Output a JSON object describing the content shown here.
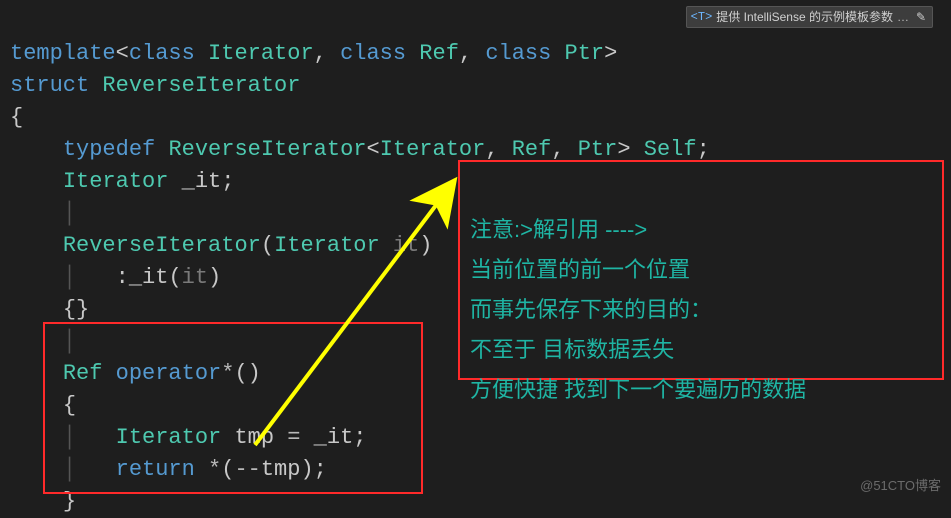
{
  "code": {
    "l1": {
      "kw1": "template",
      "punc1": "<",
      "kw2": "class",
      "sp": " ",
      "t1": "Iterator",
      "c": ", ",
      "kw3": "class",
      "t2": "Ref",
      "kw4": "class",
      "t3": "Ptr",
      "punc2": ">"
    },
    "l2": {
      "kw": "struct",
      "name": "ReverseIterator"
    },
    "l3": {
      "brace": "{"
    },
    "l4": {
      "kw": "typedef",
      "t": "ReverseIterator",
      "lt": "<",
      "a1": "Iterator",
      "a2": "Ref",
      "a3": "Ptr",
      "gt": ">",
      "self": "Self",
      "semi": ";"
    },
    "l5": {
      "t": "Iterator",
      "v": "_it",
      "semi": ";"
    },
    "l7": {
      "t": "ReverseIterator",
      "lp": "(",
      "pt": "Iterator",
      "pn": "it",
      "rp": ")"
    },
    "l8": {
      "colon": ":",
      "fn": "_it",
      "lp": "(",
      "arg": "it",
      "rp": ")"
    },
    "l9": {
      "b": "{}"
    },
    "l11": {
      "t": "Ref",
      "kw": "operator",
      "star": "*",
      "p": "()"
    },
    "l12": {
      "b": "{"
    },
    "l13": {
      "t": "Iterator",
      "v": "tmp",
      "eq": " = ",
      "r": "_it",
      "semi": ";"
    },
    "l14": {
      "kw": "return",
      "sp": " ",
      "star": "*",
      "lp": "(",
      "mm": "--",
      "v": "tmp",
      "rp": ")",
      "semi": ";"
    },
    "l15": {
      "b": "}"
    }
  },
  "annotation": {
    "l1": "注意:>解引用 ---->",
    "l2": "当前位置的前一个位置",
    "l3": "而事先保存下来的目的：",
    "l4": "不至于 目标数据丢失",
    "l5": "方便快捷 找到下一个要遍历的数据"
  },
  "hint": {
    "tag": "<T>",
    "text": "提供 IntelliSense 的示例模板参数",
    "dots": "…",
    "pen": "✎"
  },
  "watermark": "@51CTO博客"
}
